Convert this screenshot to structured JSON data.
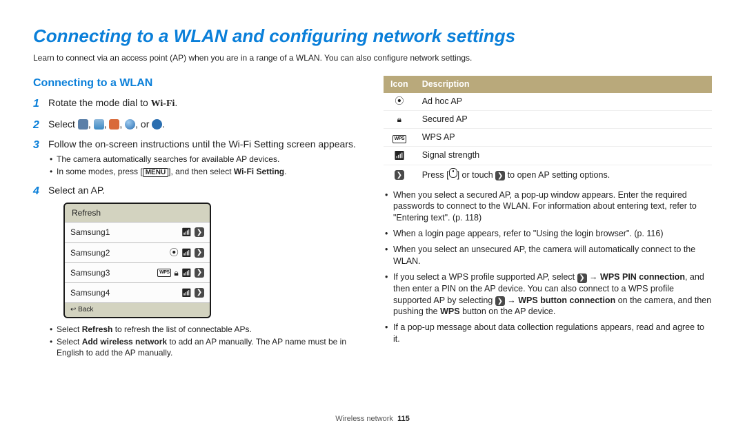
{
  "title": "Connecting to a WLAN and configuring network settings",
  "intro": "Learn to connect via an access point (AP) when you are in a range of a WLAN. You can also configure network settings.",
  "left": {
    "heading": "Connecting to a WLAN",
    "step1_pre": "Rotate the mode dial to ",
    "step1_wifi": "Wi-Fi",
    "step1_post": ".",
    "step2_pre": "Select ",
    "step2_mid": ", ",
    "step2_or": ", or ",
    "step2_end": ".",
    "step3": "Follow the on-screen instructions until the Wi-Fi Setting screen appears.",
    "step3_sub1": "The camera automatically searches for available AP devices.",
    "step3_sub2_pre": "In some modes, press [",
    "step3_sub2_menu": "MENU",
    "step3_sub2_mid": "], and then select ",
    "step3_sub2_bold": "Wi-Fi Setting",
    "step3_sub2_end": ".",
    "step4": "Select an AP.",
    "device": {
      "refresh": "Refresh",
      "rows": [
        "Samsung1",
        "Samsung2",
        "Samsung3",
        "Samsung4"
      ],
      "back": "Back"
    },
    "after1_pre": "Select ",
    "after1_bold": "Refresh",
    "after1_post": " to refresh the list of connectable APs.",
    "after2_pre": "Select ",
    "after2_bold": "Add wireless network",
    "after2_post": " to add an AP manually. The AP name must be in English to add the AP manually."
  },
  "right": {
    "thead_icon": "Icon",
    "thead_desc": "Description",
    "rows": {
      "adhoc": "Ad hoc AP",
      "secured": "Secured AP",
      "wps": "WPS AP",
      "signal": "Signal strength",
      "press_pre": "Press [",
      "press_mid": "] or touch ",
      "press_end": " to open AP setting options."
    },
    "note1": "When you select a secured AP, a pop-up window appears. Enter the required passwords to connect to the WLAN. For information about entering text, refer to \"Entering text\". (p. 118)",
    "note2": "When a login page appears, refer to \"Using the login browser\". (p. 116)",
    "note3": "When you select an unsecured AP, the camera will automatically connect to the WLAN.",
    "note4_pre": "If you select a WPS profile supported AP, select ",
    "note4_arrow": " → ",
    "note4_b1": "WPS PIN connection",
    "note4_mid": ", and then enter a PIN on the AP device. You can also connect to a WPS profile supported AP by selecting ",
    "note4_b2": "WPS button connection",
    "note4_mid2": " on the camera, and then pushing the ",
    "note4_b3": "WPS",
    "note4_end": " button on the AP device.",
    "note5": "If a pop-up message about data collection regulations appears, read and agree to it."
  },
  "footer": {
    "section": "Wireless network",
    "page": "115"
  }
}
